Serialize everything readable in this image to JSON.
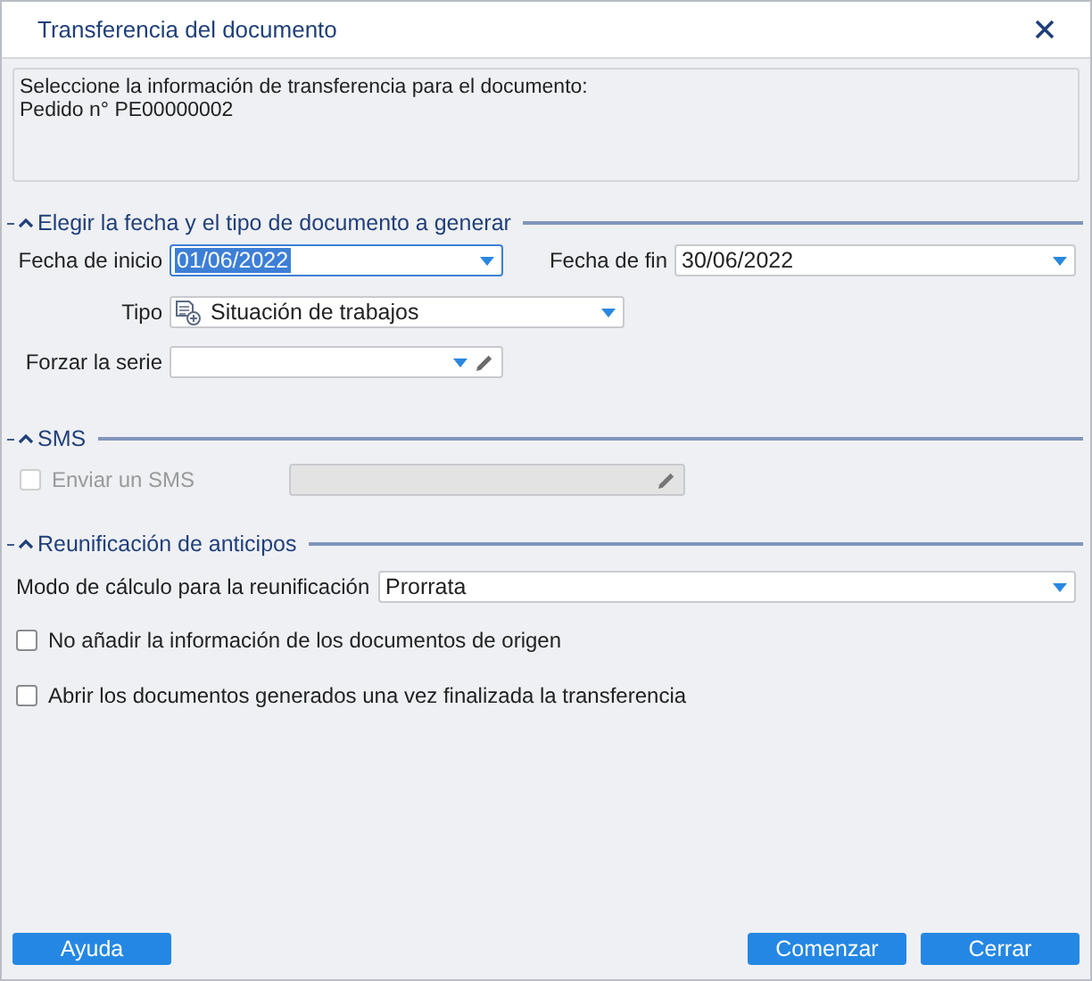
{
  "window": {
    "title": "Transferencia del documento"
  },
  "info": {
    "lines": [
      "Seleccione la información de transferencia para el documento:",
      "Pedido n° PE00000002"
    ]
  },
  "date_section": {
    "title": "Elegir la fecha y el tipo de documento a generar",
    "expanded": true,
    "start_date": {
      "label": "Fecha de inicio",
      "value": "01/06/2022",
      "focused": true
    },
    "end_date": {
      "label": "Fecha de fin",
      "value": "30/06/2022",
      "focused": false
    },
    "type": {
      "label": "Tipo",
      "value": "Situación de trabajos"
    },
    "series": {
      "label": "Forzar la serie"
    }
  },
  "sms_section": {
    "title": "SMS",
    "expanded": true,
    "send_sms": {
      "label": "Enviar un SMS",
      "checked": false,
      "disabled": true
    }
  },
  "advance_section": {
    "title": "Reunificación de anticipos",
    "expanded": true,
    "calc_mode": {
      "label": "Modo de cálculo para la reunificación",
      "value": "Prorrata"
    },
    "options": [
      {
        "label": "No añadir la información de los documentos de origen",
        "checked": false
      },
      {
        "label": "Abrir los documentos generados una vez finalizada la transferencia",
        "checked": false
      }
    ]
  },
  "footer": {
    "left_buttons": [
      "Ayuda"
    ],
    "right_buttons": [
      "Comenzar",
      "Cerrar"
    ]
  }
}
